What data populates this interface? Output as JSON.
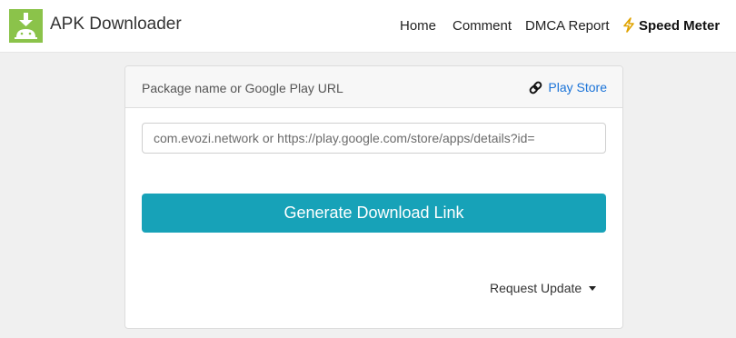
{
  "brand": {
    "name": "APK Downloader",
    "logo_icon": "android-download-icon",
    "logo_color": "#8bc34a"
  },
  "nav": {
    "items": [
      {
        "label": "Home"
      },
      {
        "label": "Comment"
      },
      {
        "label": "DMCA Report"
      }
    ],
    "speed_meter": {
      "label": "Speed Meter",
      "icon": "lightning-icon"
    }
  },
  "form": {
    "header_label": "Package name or Google Play URL",
    "playstore_link": {
      "label": "Play Store",
      "icon": "link-icon"
    },
    "input": {
      "value": "",
      "placeholder": "com.evozi.network or https://play.google.com/store/apps/details?id="
    },
    "generate_button": "Generate Download Link",
    "request_update": "Request Update"
  },
  "colors": {
    "accent": "#17a2b8",
    "link": "#1a73d8"
  }
}
